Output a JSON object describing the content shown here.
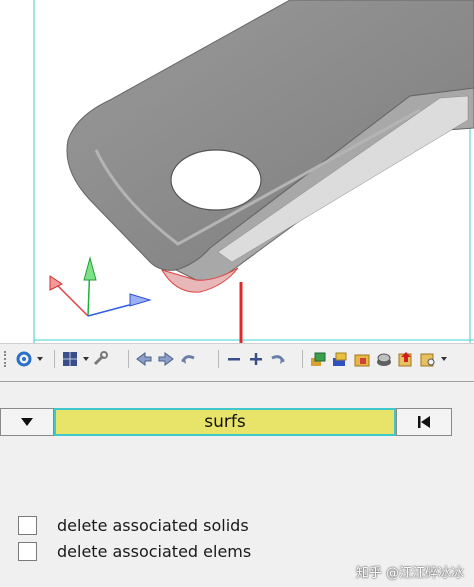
{
  "viewport": {
    "colors": {
      "part": "#8c8c8c",
      "highlight": "#e08a8a",
      "callout": "#e02828",
      "frame": "#40d0d0"
    }
  },
  "toolbar": {
    "icons": [
      "rotate-icon",
      "mesh-grid-icon",
      "wrench-icon",
      "arrow-left-icon",
      "arrow-right-icon",
      "undo-icon",
      "minus-icon",
      "plus-icon",
      "redo-icon",
      "component-icon",
      "component-blue-icon",
      "folder-icon",
      "solid-icon",
      "export-icon",
      "review-icon"
    ]
  },
  "selector": {
    "field_label": "surfs"
  },
  "options": [
    {
      "label": "delete associated solids",
      "checked": false
    },
    {
      "label": "delete associated elems",
      "checked": false
    }
  ],
  "watermark": {
    "text": "知乎 @汪汪碎冰冰"
  }
}
